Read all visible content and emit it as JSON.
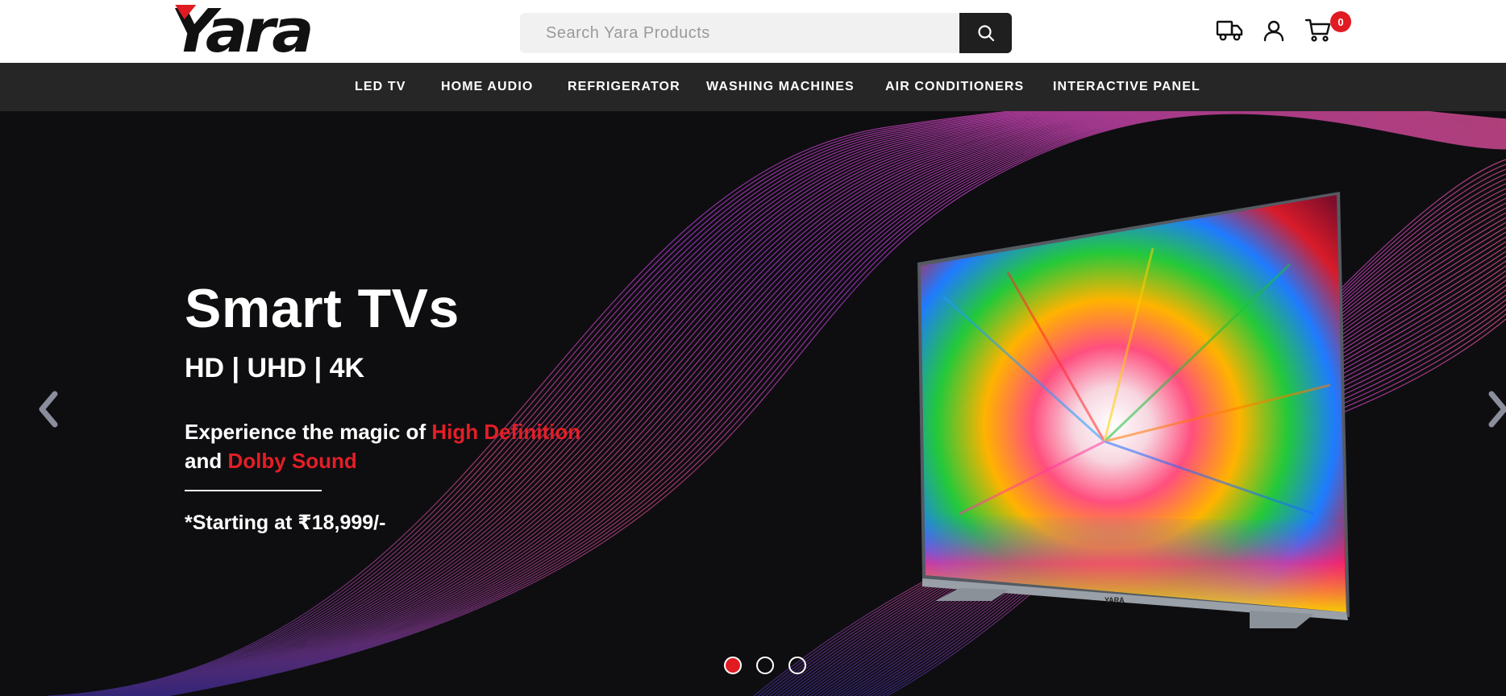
{
  "brand": {
    "name": "Yara",
    "accent_color": "#e01b22"
  },
  "search": {
    "placeholder": "Search Yara Products",
    "value": ""
  },
  "header_icons": [
    {
      "name": "delivery-truck-icon"
    },
    {
      "name": "user-icon"
    },
    {
      "name": "cart-icon"
    }
  ],
  "cart": {
    "count": "0"
  },
  "nav": {
    "items": [
      {
        "label": "LED TV"
      },
      {
        "label": "HOME AUDIO"
      },
      {
        "label": "REFRIGERATOR"
      },
      {
        "label": "WASHING MACHINES"
      },
      {
        "label": "AIR CONDITIONERS"
      },
      {
        "label": "INTERACTIVE PANEL"
      }
    ]
  },
  "hero": {
    "title": "Smart TVs",
    "subtitle": "HD | UHD | 4K",
    "desc_part1": "Experience the magic of ",
    "desc_highlight1": "High Definition",
    "desc_part2": "and ",
    "desc_highlight2": "Dolby Sound",
    "price": "*Starting at ₹18,999/-",
    "tv_brand": "YARA",
    "highlight_color": "#e41e26"
  },
  "carousel": {
    "slides": 3,
    "active_index": 0
  }
}
